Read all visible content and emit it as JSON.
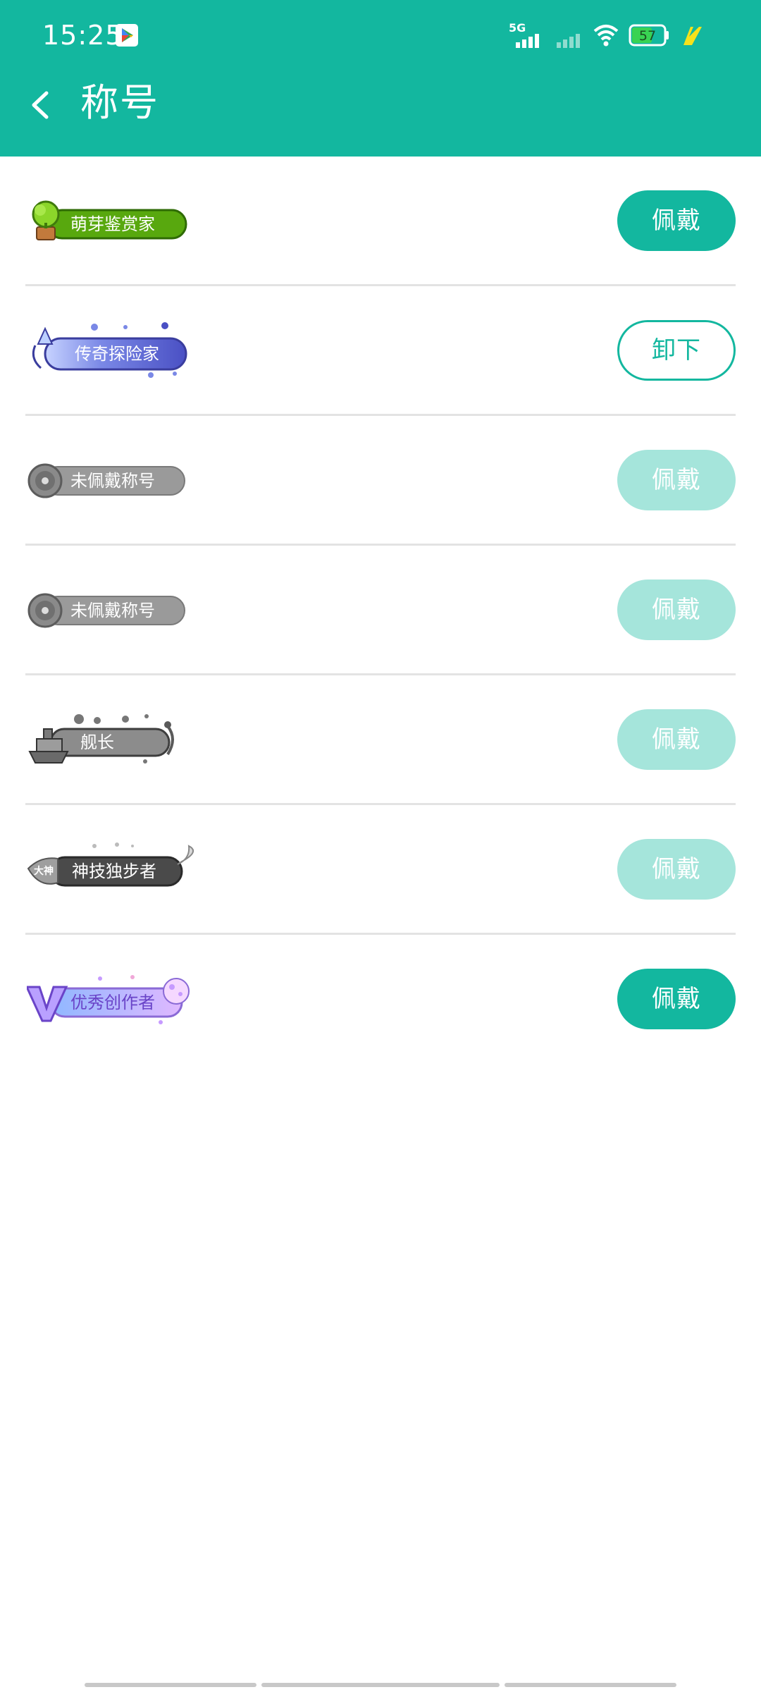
{
  "status_bar": {
    "time": "15:25",
    "network": "5G",
    "battery": "57"
  },
  "header": {
    "title": "称号"
  },
  "titles": [
    {
      "name": "萌芽鉴赏家",
      "action": "佩戴",
      "state": "active"
    },
    {
      "name": "传奇探险家",
      "action": "卸下",
      "state": "equipped"
    },
    {
      "name": "未佩戴称号",
      "action": "佩戴",
      "state": "disabled"
    },
    {
      "name": "未佩戴称号",
      "action": "佩戴",
      "state": "disabled"
    },
    {
      "name": "舰长",
      "action": "佩戴",
      "state": "disabled"
    },
    {
      "name": "神技独步者",
      "action": "佩戴",
      "state": "disabled"
    },
    {
      "name": "优秀创作者",
      "action": "佩戴",
      "state": "active"
    }
  ],
  "badge_decorations": {
    "tag_6": "大神"
  },
  "colors": {
    "accent": "#13b79f",
    "button_disabled": "#a5e5db",
    "divider": "#e3e3e3"
  }
}
